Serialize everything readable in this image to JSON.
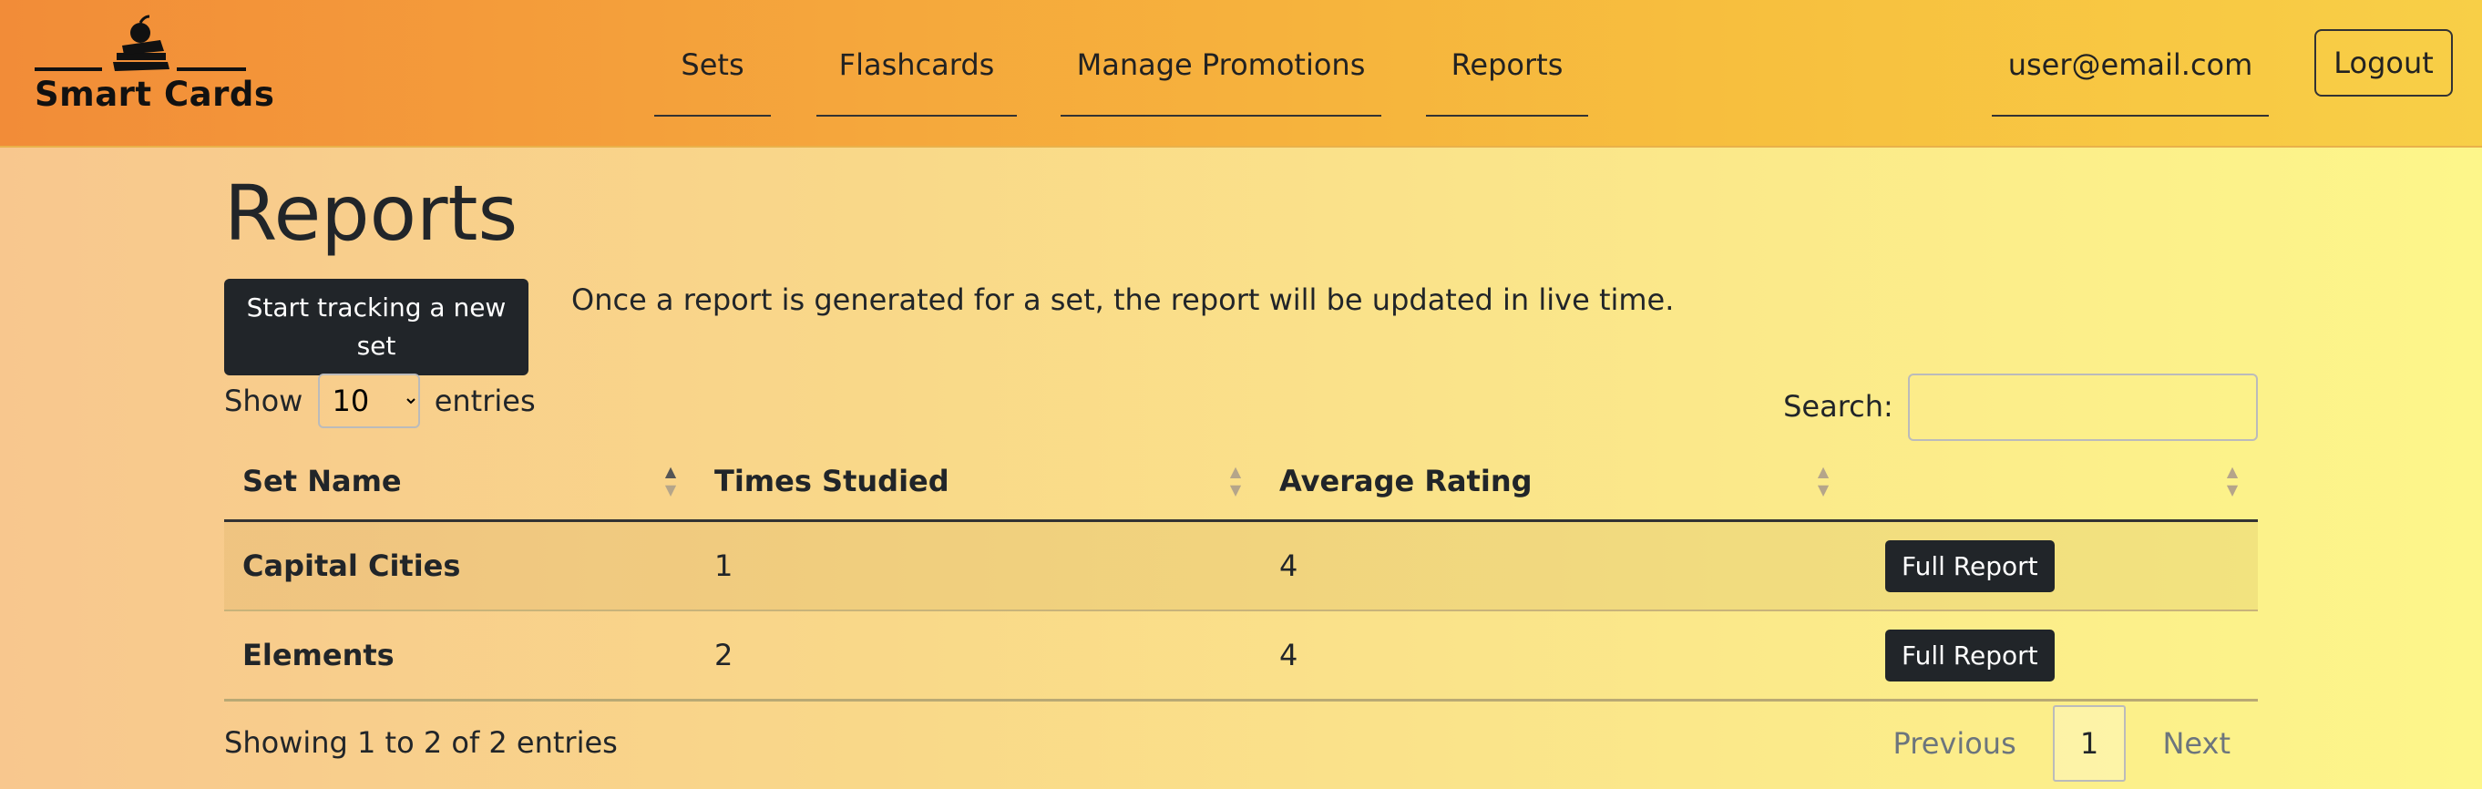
{
  "header": {
    "brand": "Smart Cards",
    "nav": [
      "Sets",
      "Flashcards",
      "Manage Promotions",
      "Reports"
    ],
    "user_email": "user@email.com",
    "logout_label": "Logout"
  },
  "main": {
    "title": "Reports",
    "track_button_label": "Start tracking a new set",
    "info_text": "Once a report is generated for a set, the report will be updated in live time.",
    "length": {
      "show_label": "Show",
      "selected": "10",
      "entries_label": "entries"
    },
    "search": {
      "label": "Search:",
      "value": ""
    },
    "table": {
      "columns": [
        "Set Name",
        "Times Studied",
        "Average Rating",
        ""
      ],
      "rows": [
        {
          "set_name": "Capital Cities",
          "times_studied": "1",
          "average_rating": "4",
          "action": "Full Report"
        },
        {
          "set_name": "Elements",
          "times_studied": "2",
          "average_rating": "4",
          "action": "Full Report"
        }
      ]
    },
    "footer_info": "Showing 1 to 2 of 2 entries",
    "pagination": {
      "previous": "Previous",
      "current": "1",
      "next": "Next"
    }
  }
}
